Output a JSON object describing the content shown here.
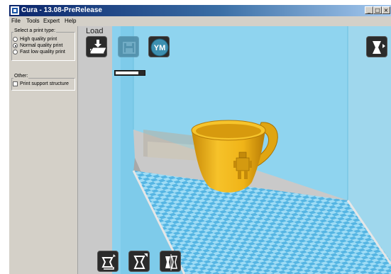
{
  "window": {
    "title": "Cura - 13.08-PreRelease",
    "caption_buttons": [
      "_",
      "□",
      "×"
    ]
  },
  "menu": [
    "File",
    "Tools",
    "Expert",
    "Help"
  ],
  "print_type": {
    "label": "Select a print type:",
    "options": [
      {
        "label": "High quality print",
        "selected": false
      },
      {
        "label": "Normal quality print",
        "selected": true
      },
      {
        "label": "Fast low quality print",
        "selected": false
      }
    ]
  },
  "other": {
    "label": "Other:",
    "support": {
      "label": "Print support structure",
      "checked": false
    }
  },
  "toolbar": {
    "load_label": "Load",
    "load_icon": "load-icon",
    "save_icon": "save-icon",
    "youmagine_label": "YM",
    "view_mode_icon": "view-mode-icon",
    "progress": 0.8
  },
  "bottom_tools": [
    "rotate-icon",
    "scale-icon",
    "mirror-icon"
  ],
  "colors": {
    "build_volume": "#8fd4ef",
    "platform_light": "#9fdcf5",
    "platform_dark": "#55b5e3",
    "model": "#f0b418",
    "viewport_bg": "#c9c9c9"
  }
}
